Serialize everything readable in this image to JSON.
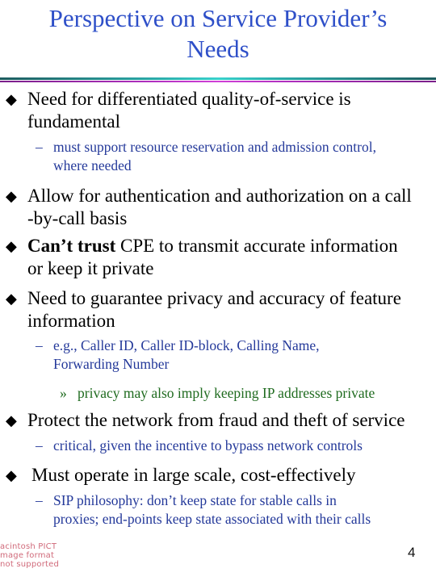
{
  "slide": {
    "title_line1": "Perspective on Service Provider’s",
    "title_line2": "Needs",
    "page_number": "4",
    "colors": {
      "title": "#2e4fc8",
      "subbullet": "#24399a",
      "subsubbullet": "#1f6b1f",
      "placeholder_text": "#d06a7a"
    }
  },
  "bullets": [
    {
      "lines": [
        "Need for differentiated quality-of-service is",
        "fundamental"
      ],
      "sub": [
        {
          "lines": [
            "must support resource reservation and admission control,",
            "where needed"
          ]
        }
      ]
    },
    {
      "lines": [
        "Allow for authentication and authorization on a call",
        "-by-call basis"
      ]
    },
    {
      "bold_prefix": "Can’t trust",
      "rest_first_line": " CPE to transmit accurate information",
      "lines": [
        "",
        "or keep it private"
      ]
    },
    {
      "lines": [
        "Need to guarantee privacy and accuracy of feature",
        "information"
      ],
      "sub": [
        {
          "lines": [
            "e.g., Caller ID, Caller ID-block, Calling Name,",
            "Forwarding Number"
          ],
          "sub": [
            {
              "lines": [
                "privacy may also imply keeping IP addresses private"
              ]
            }
          ]
        }
      ]
    },
    {
      "lines": [
        "Protect the network from fraud and theft of service"
      ],
      "sub": [
        {
          "lines": [
            "critical, given the incentive to bypass network controls"
          ]
        }
      ]
    },
    {
      "lines": [
        "Must operate in large scale, cost-effectively"
      ],
      "sub": [
        {
          "lines": [
            "SIP philosophy: don’t keep state for stable calls in",
            "proxies; end-points keep state associated with their calls"
          ]
        }
      ]
    }
  ],
  "glyphs": {
    "bullet": "◆",
    "dash": "–",
    "raquo": "»"
  },
  "pict_placeholder": [
    "acintosh PICT",
    "mage format",
    "not supported"
  ]
}
